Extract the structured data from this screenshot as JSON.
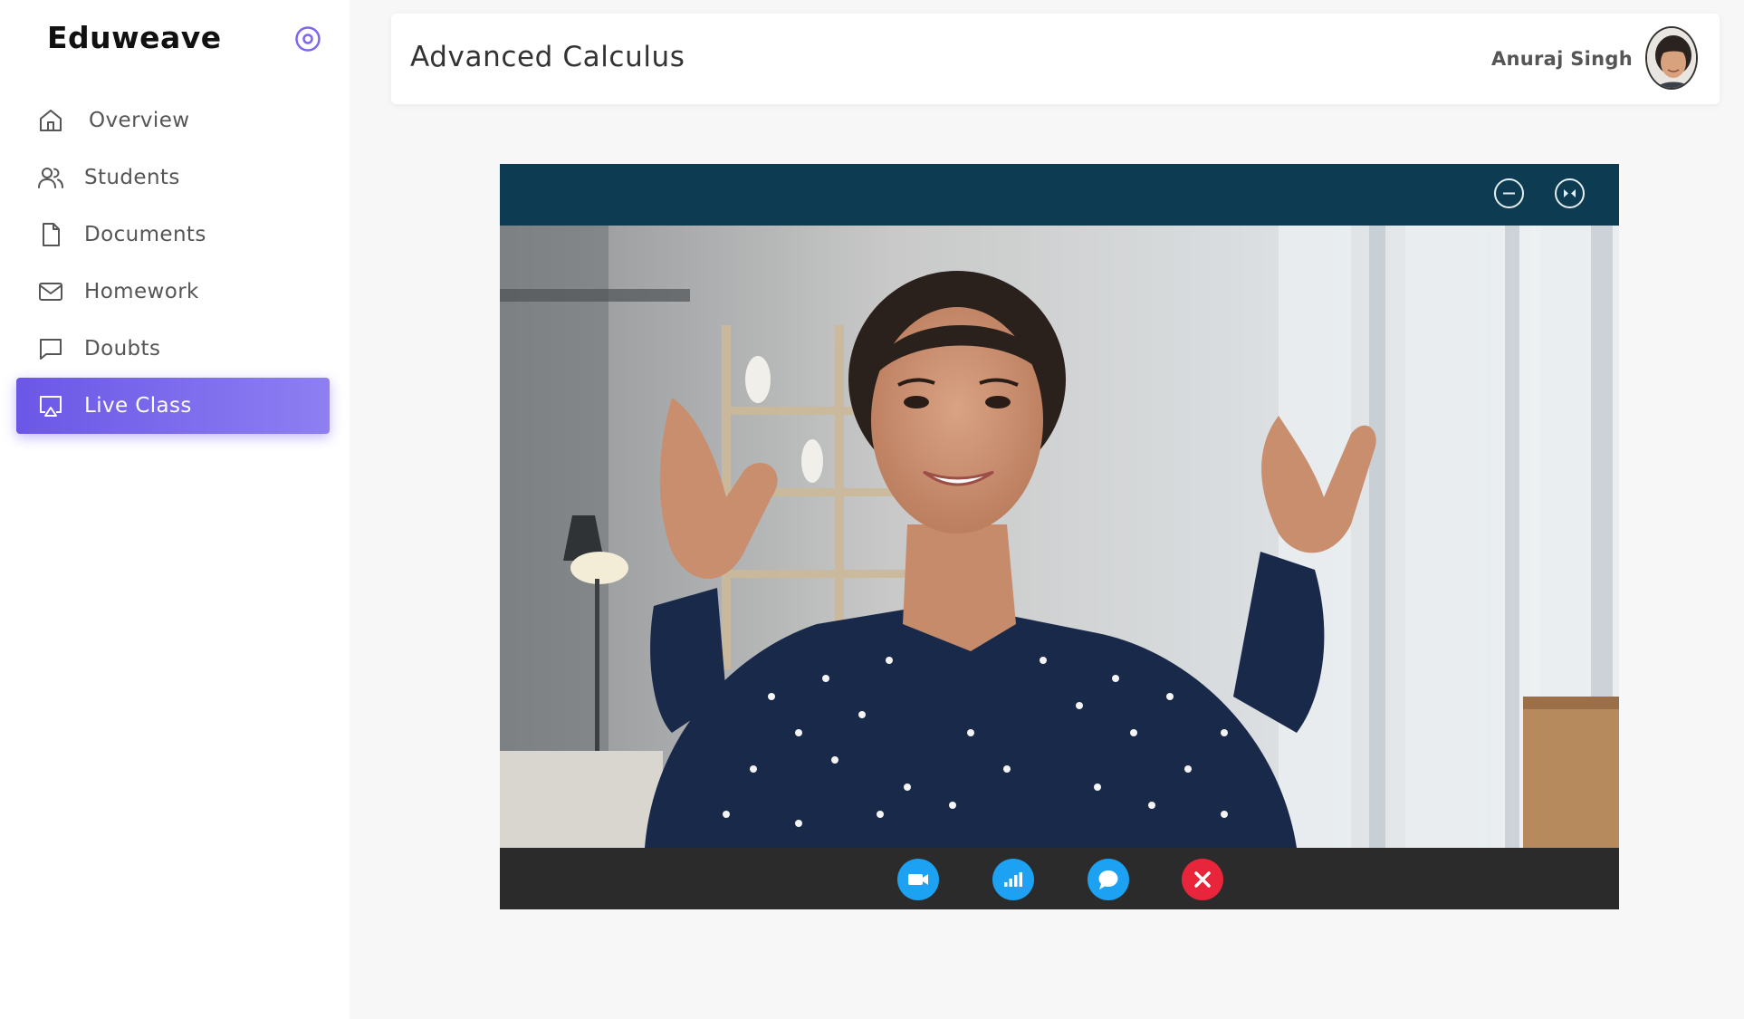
{
  "brand": {
    "name": "Eduweave"
  },
  "sidebar": {
    "items": [
      {
        "label": "Overview",
        "icon": "home-icon"
      },
      {
        "label": "Students",
        "icon": "users-icon"
      },
      {
        "label": "Documents",
        "icon": "file-icon"
      },
      {
        "label": "Homework",
        "icon": "mail-icon"
      },
      {
        "label": "Doubts",
        "icon": "chat-bubble-icon"
      },
      {
        "label": "Live Class",
        "icon": "screen-cast-icon",
        "active": true
      }
    ]
  },
  "header": {
    "title": "Advanced Calculus",
    "user_name": "Anuraj Singh"
  },
  "video": {
    "window_controls": [
      "minimize-icon",
      "collapse-icon"
    ],
    "controls": [
      {
        "name": "video-camera-icon",
        "color": "#1da1f2"
      },
      {
        "name": "signal-bars-icon",
        "color": "#1da1f2"
      },
      {
        "name": "chat-icon",
        "color": "#1da1f2"
      },
      {
        "name": "end-call-icon",
        "color": "#e8253a"
      }
    ]
  },
  "colors": {
    "accent": "#7b68ee",
    "video_topbar": "#0c3b52",
    "video_bottombar": "#2b2b2b"
  }
}
